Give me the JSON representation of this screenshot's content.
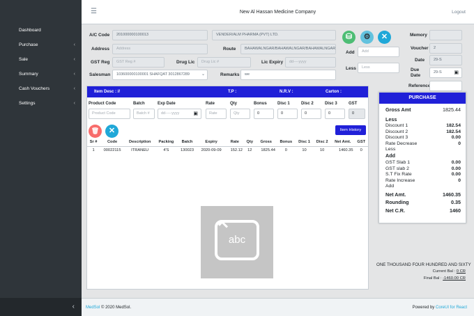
{
  "colors": {
    "accent": "#2020d8",
    "success": "#4dbd74",
    "danger": "#f86c6b",
    "info": "#20a8d8",
    "sidebar": "#2f353a"
  },
  "sidebar": {
    "items": [
      {
        "label": "Dashboard",
        "has_chevron": false
      },
      {
        "label": "Purchase",
        "has_chevron": true
      },
      {
        "label": "Sale",
        "has_chevron": true
      },
      {
        "label": "Summary",
        "has_chevron": true
      },
      {
        "label": "Cash Vouchers",
        "has_chevron": true
      },
      {
        "label": "Settings",
        "has_chevron": true
      }
    ],
    "minimize_icon": "chevron-left-icon"
  },
  "header": {
    "menu_icon": "hamburger-icon",
    "title": "New Al Hassan Medicine Company",
    "logout": "Logout"
  },
  "form": {
    "ac_code": {
      "label": "A/C Code",
      "value": "201000000100013"
    },
    "vendor": {
      "value": "VENDER/ALM PHARMA (PVT) LTD."
    },
    "address": {
      "label": "Address",
      "placeholder": "Address"
    },
    "route": {
      "label": "Route",
      "value": "BAHAWALNGAR/BAHAWALNGAR/BAHAWALNGAR"
    },
    "gst_reg": {
      "label": "GST Reg",
      "placeholder": "GST Reg #"
    },
    "drug_lic": {
      "label": "Drug Lic",
      "placeholder": "Drug Lic #"
    },
    "lic_expiry": {
      "label": "Lic Expiry",
      "placeholder": "dd----yyyy"
    },
    "salesman": {
      "label": "Salesman",
      "value": "103600000100001 SHAFQAT 3012867289"
    },
    "remarks": {
      "label": "Remarks",
      "value": "we"
    },
    "add": {
      "label": "Add",
      "placeholder": "Add"
    },
    "less": {
      "label": "Less",
      "placeholder": "Less"
    },
    "memory": {
      "label": "Memory",
      "value": ""
    },
    "voucher": {
      "label": "Voucher",
      "value": "2"
    },
    "date": {
      "label": "Date",
      "value": "29-S"
    },
    "due_date": {
      "label": "Due Date",
      "value": "29-S"
    },
    "reference": {
      "label": "Reference",
      "value": ""
    }
  },
  "items_panel": {
    "head": {
      "item_desc": "Item Desc : //",
      "tp": "T.P :",
      "nrv": "N.R.V :",
      "carton": "Carton :"
    },
    "entry_headers": [
      "Product Code",
      "Batch",
      "Exp Date",
      "Rate",
      "Qty",
      "Bonus",
      "Disc 1",
      "Disc 2",
      "Disc 3",
      "GST"
    ],
    "entry_placeholders": {
      "product_code": "Product Code",
      "batch": "Batch #",
      "exp_date": "dd-----yyyy",
      "rate": "Rate",
      "qty": "Qty",
      "bonus": "0",
      "disc1": "0",
      "disc2": "0",
      "disc3": "0",
      "gst": "0"
    },
    "item_history": "Item History",
    "table": {
      "headers": [
        "Sr #",
        "Code",
        "Description",
        "Packing",
        "Batch",
        "Expiry",
        "Rate",
        "Qty",
        "Gross",
        "Bonus",
        "Disc 1",
        "Disc 2",
        "Net Amt.",
        "GST"
      ],
      "rows": [
        [
          "1",
          "00022115",
          "ITRANEU",
          "4'S",
          "130023",
          "2020-09-09",
          "152.12",
          "12",
          "1825.44",
          "0",
          "10",
          "10",
          "1460.35",
          "0"
        ]
      ]
    }
  },
  "purchase": {
    "title": "PURCHASE",
    "gross_amt": {
      "label": "Gross Amt",
      "value": "1825.44"
    },
    "less_label": "Less",
    "discount1": {
      "label": "Discount 1",
      "value": "182.54"
    },
    "discount2": {
      "label": "Discount 2",
      "value": "182.54"
    },
    "discount3": {
      "label": "Discount 3",
      "value": "0.00"
    },
    "rate_decrease": {
      "label": "Rate Decrease",
      "value": "0"
    },
    "less2_label": "Less",
    "add_label": "Add",
    "gst_slab1": {
      "label": "GST Slab 1",
      "value": "0.00"
    },
    "gst_slab2": {
      "label": "GST slab 2",
      "value": "0.00"
    },
    "st_fix_rate": {
      "label": "S.T Fix Rate",
      "value": "0.00"
    },
    "rate_increase": {
      "label": "Rate Increase",
      "value": "0"
    },
    "add2_label": "Add",
    "net_amt": {
      "label": "Net Amt.",
      "value": "1460.35"
    },
    "rounding": {
      "label": "Rounding",
      "value": "0.35"
    },
    "net_cr": {
      "label": "Net C.R.",
      "value": "1460"
    }
  },
  "totals": {
    "words": "ONE THOUSAND FOUR HUNDRED AND SIXTY",
    "current_bal_label": "Current Bal : ",
    "current_bal": "0 CR",
    "final_bal_label": "Final Bal : ",
    "final_bal": "-1460.00 CR"
  },
  "overlay": {
    "text": "abc"
  },
  "footer": {
    "brand": "MedSol",
    "copyright": " © 2020 MedSol.",
    "powered_by": "Powered by ",
    "powered_link": "CoreUI for React"
  }
}
